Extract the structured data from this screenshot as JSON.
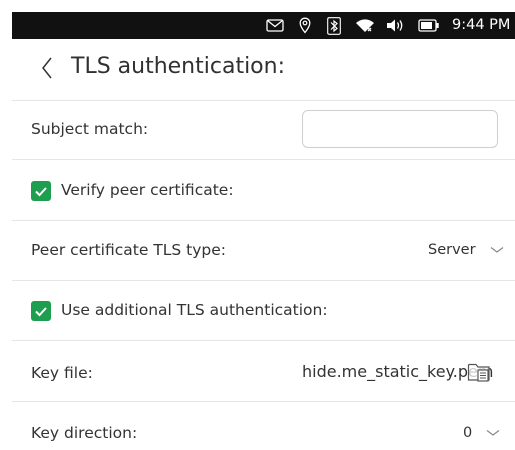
{
  "status_bar": {
    "icons": [
      "mail-icon",
      "location-icon",
      "bluetooth-icon",
      "wifi-icon",
      "volume-icon",
      "battery-icon"
    ],
    "time": "9:44 PM"
  },
  "header": {
    "back_icon": "chevron-left-icon",
    "title": "TLS authentication:"
  },
  "form": {
    "subject_match": {
      "label": "Subject match:",
      "value": ""
    },
    "verify_peer": {
      "label": "Verify peer certificate:",
      "checked": true
    },
    "peer_cert_type": {
      "label": "Peer certificate TLS type:",
      "value": "Server"
    },
    "additional_tls": {
      "label": "Use additional TLS authentication:",
      "checked": true
    },
    "key_file": {
      "label": "Key file:",
      "value": "hide.me_static_key.pem",
      "icon": "file-picker-icon"
    },
    "key_direction": {
      "label": "Key direction:",
      "value": "0"
    }
  },
  "colors": {
    "status_bar_bg": "#111111",
    "checkbox_accent": "#1e9e4f",
    "divider": "#e6e6e6"
  }
}
